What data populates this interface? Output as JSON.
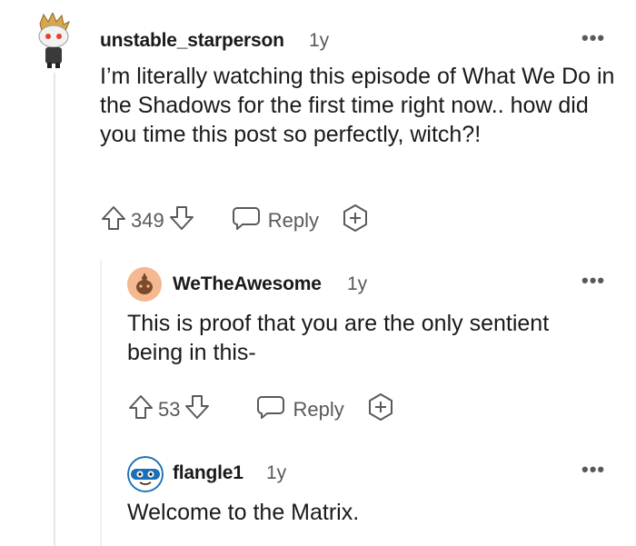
{
  "comments": [
    {
      "username": "unstable_starperson",
      "age": "1y",
      "body": "I’m literally watching this episode of What We Do in the Shadows for the first time right now.. how did you time this post so perfectly, witch?!",
      "score": "349",
      "reply_label": "Reply",
      "more_label": "•••"
    },
    {
      "username": "WeTheAwesome",
      "age": "1y",
      "body": "This is proof that you are the only sentient being in this-",
      "score": "53",
      "reply_label": "Reply",
      "more_label": "•••"
    },
    {
      "username": "flangle1",
      "age": "1y",
      "body": "Welcome to the Matrix.",
      "more_label": "•••"
    }
  ],
  "colors": {
    "text": "#1a1a1b",
    "meta": "#575a5c",
    "thread_line": "#e5e7eb"
  }
}
